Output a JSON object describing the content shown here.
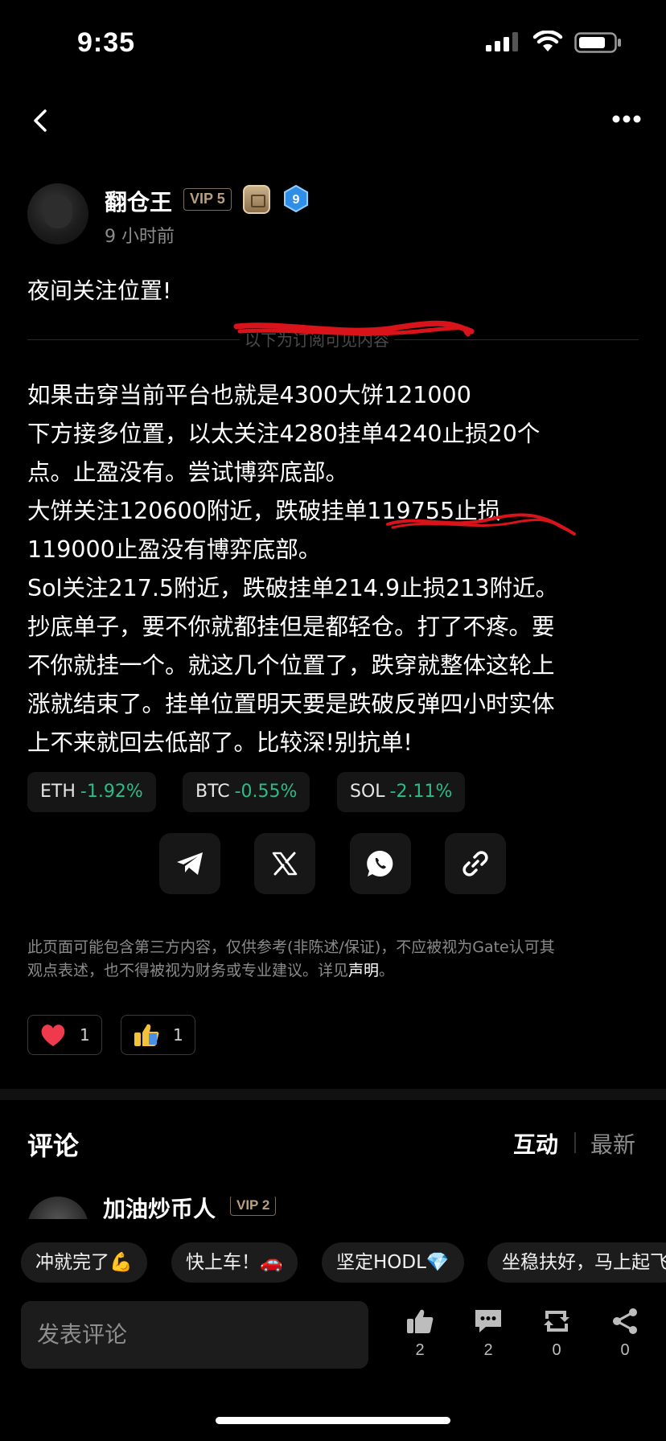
{
  "status_bar": {
    "time": "9:35"
  },
  "author": {
    "name": "翻仓王",
    "vip": "VIP 5",
    "level_badge": "9",
    "time_ago": "9 小时前"
  },
  "post": {
    "title": "夜间关注位置!",
    "divider_label": "以下为订阅可见内容",
    "body_lines": [
      "如果击穿当前平台也就是4300大饼121000",
      "下方接多位置，以太关注4280挂单4240止损20个",
      "点。止盈没有。尝试博弈底部。",
      "大饼关注120600附近，跌破挂单119755止损",
      "119000止盈没有博弈底部。",
      "Sol关注217.5附近，跌破挂单214.9止损213附近。",
      "抄底单子，要不你就都挂但是都轻仓。打了不疼。要",
      "不你就挂一个。就这几个位置了，跌穿就整体这轮上",
      "涨就结束了。挂单位置明天要是跌破反弹四小时实体",
      "上不来就回去低部了。比较深!别抗单!"
    ]
  },
  "tickers": [
    {
      "symbol": "ETH",
      "change": "-1.92%"
    },
    {
      "symbol": "BTC",
      "change": "-0.55%"
    },
    {
      "symbol": "SOL",
      "change": "-2.11%"
    }
  ],
  "share_icons": [
    "telegram-icon",
    "x-icon",
    "whatsapp-icon",
    "link-icon"
  ],
  "disclaimer": {
    "line1": "此页面可能包含第三方内容，仅供参考(非陈述/保证)，不应被视为Gate认可其",
    "line2_prefix": "观点表述，也不得被视为财务或专业建议。详见",
    "link": "声明",
    "suffix": "。"
  },
  "reactions": [
    {
      "icon": "heart-icon",
      "count": "1"
    },
    {
      "icon": "thumbs-up-icon",
      "count": "1"
    }
  ],
  "comments": {
    "title": "评论",
    "sort_active": "互动",
    "sort_inactive": "最新",
    "first_user": "加油炒币人",
    "first_user_vip": "VIP 2"
  },
  "quick_replies": [
    "冲就完了💪",
    "快上车！🚗",
    "坚定HODL💎",
    "坐稳扶好，马上起飞"
  ],
  "bottom_bar": {
    "placeholder": "发表评论",
    "likes": "2",
    "comments": "2",
    "reposts": "0",
    "shares": "0"
  },
  "colors": {
    "positive": "#2bbd87",
    "background": "#000000",
    "accent_red": "#e02020"
  }
}
